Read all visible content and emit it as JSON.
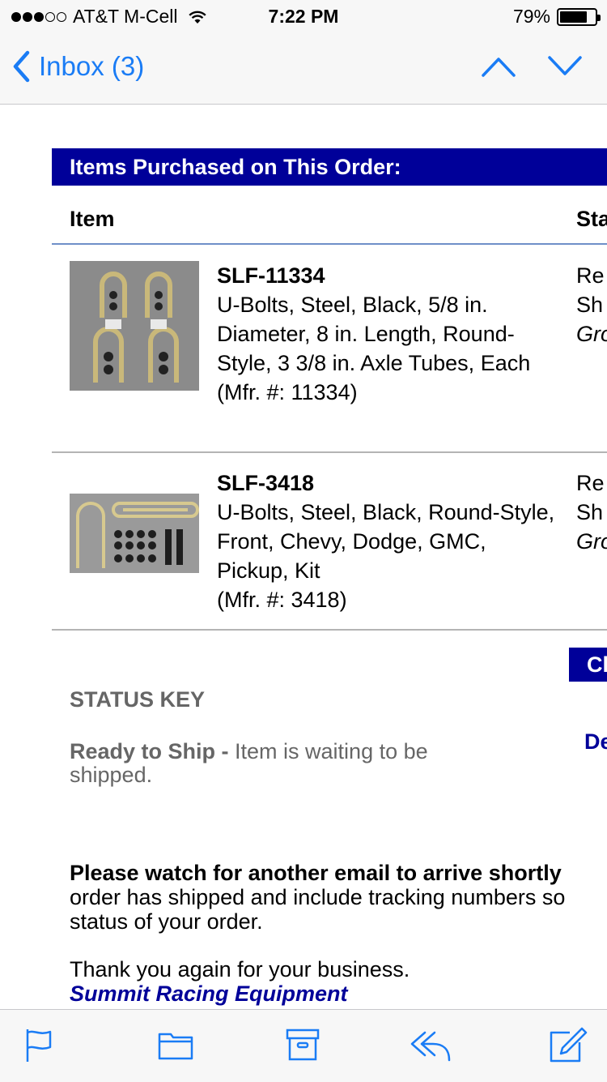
{
  "status_bar": {
    "carrier": "AT&T M-Cell",
    "signal_bars_filled": 3,
    "signal_bars_total": 5,
    "time": "7:22 PM",
    "battery_percent": "79%",
    "battery_level": 0.79
  },
  "nav": {
    "back_label": "Inbox (3)",
    "accent_color": "#1a7cf5"
  },
  "email": {
    "section_title": "Items Purchased on This Order:",
    "col_item": "Item",
    "col_status": "Sta",
    "items": [
      {
        "sku": "SLF-11334",
        "description": "U-Bolts, Steel, Black, 5/8 in. Diameter, 8 in. Length, Round-Style, 3 3/8 in. Axle Tubes, Each",
        "mfr": "(Mfr. #: 11334)",
        "status_line1": "Re",
        "status_line2": "Sh",
        "status_line3": "Gro"
      },
      {
        "sku": "SLF-3418",
        "description": "U-Bolts, Steel, Black, Round-Style, Front, Chevy, Dodge, GMC, Pickup, Kit",
        "mfr": "(Mfr. #: 3418)",
        "status_line1": "Re",
        "status_line2": "Sh",
        "status_line3": "Gro"
      }
    ],
    "check_button": "Cl",
    "status_key_title": "STATUS KEY",
    "status_key_term": "Ready to Ship -",
    "status_key_desc": "Item is waiting to be shipped.",
    "de_link": "De",
    "watch_bold": "Please watch for another email to arrive shortly",
    "watch_line2": "order has shipped and include tracking numbers so",
    "watch_line3": "status of your order.",
    "thanks": "Thank you again for your business.",
    "signature": "Summit Racing Equipment",
    "brand_color": "#000099"
  },
  "toolbar": {
    "icons": [
      "flag-icon",
      "folder-icon",
      "archive-icon",
      "reply-icon",
      "compose-icon"
    ],
    "icon_color": "#1a7cf5"
  }
}
